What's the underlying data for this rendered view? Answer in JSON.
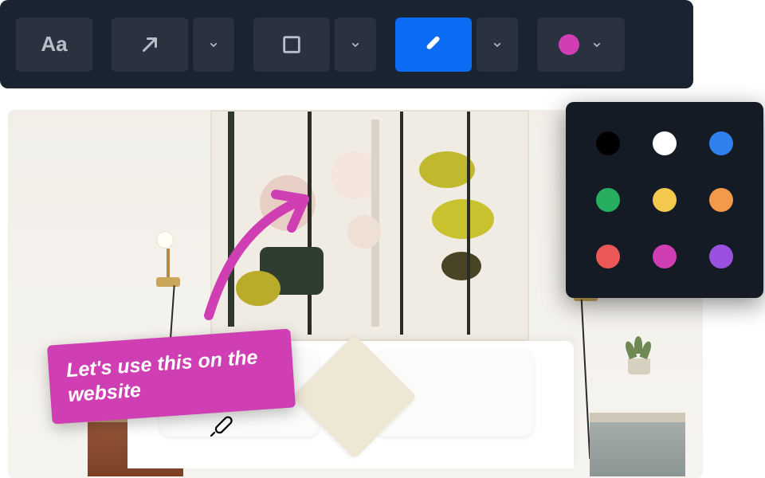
{
  "toolbar": {
    "text_tool_label": "Aa",
    "tools": {
      "arrow": {
        "name": "arrow-tool"
      },
      "shape": {
        "name": "rectangle-tool"
      },
      "pen": {
        "name": "pen-tool",
        "active": true
      },
      "color": {
        "name": "color-tool",
        "current": "#cf3fb3"
      }
    }
  },
  "palette": {
    "colors": [
      {
        "name": "black",
        "hex": "#000000"
      },
      {
        "name": "white",
        "hex": "#ffffff"
      },
      {
        "name": "blue",
        "hex": "#2f80ed"
      },
      {
        "name": "green",
        "hex": "#27ae60"
      },
      {
        "name": "yellow",
        "hex": "#f2c94c"
      },
      {
        "name": "orange",
        "hex": "#f2994a"
      },
      {
        "name": "red",
        "hex": "#eb5757"
      },
      {
        "name": "magenta",
        "hex": "#cf3fb3"
      },
      {
        "name": "purple",
        "hex": "#9b51e0"
      }
    ]
  },
  "annotation": {
    "arrow_color": "#cf3fb3",
    "comment_text": "Let's use this on the website"
  }
}
